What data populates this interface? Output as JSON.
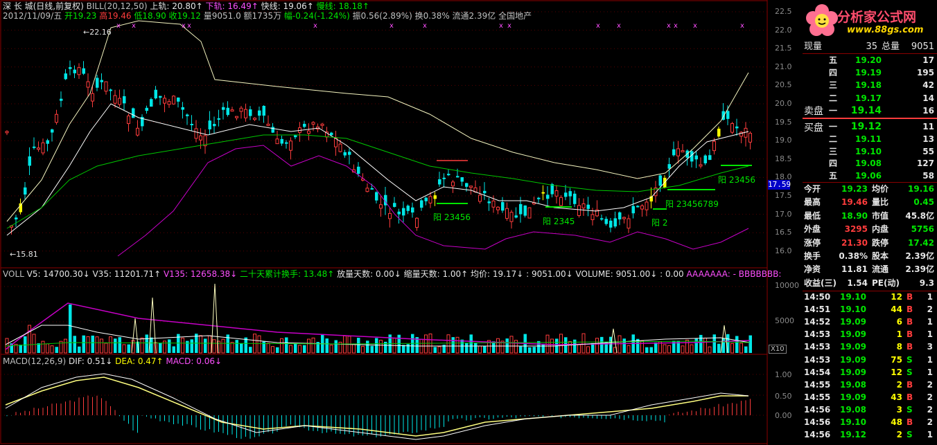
{
  "header": {
    "line1": [
      {
        "t": "深 长 城(日线,前复权)",
        "c": "#e6e6e6"
      },
      {
        "t": " BILL(20,12,50)",
        "c": "#c0c0c0"
      },
      {
        "t": " 上轨: 20.80↑",
        "c": "#e6e6e6"
      },
      {
        "t": " 下轨: 16.49↑",
        "c": "#ff50ff"
      },
      {
        "t": " 快线: 19.06↑",
        "c": "#e6e6e6"
      },
      {
        "t": " 慢线: 18.18↑",
        "c": "#00e600"
      }
    ],
    "line2": [
      {
        "t": "2012/11/09/五",
        "c": "#c0c0c0"
      },
      {
        "t": " 开19.23",
        "c": "#00e600"
      },
      {
        "t": " 高19.46",
        "c": "#ff3c3c"
      },
      {
        "t": " 低18.90",
        "c": "#00e600"
      },
      {
        "t": " 收19.12",
        "c": "#00e600"
      },
      {
        "t": " 量9051.0",
        "c": "#c0c0c0"
      },
      {
        "t": " 额1735万",
        "c": "#c0c0c0"
      },
      {
        "t": " 幅-0.24(-1.24%)",
        "c": "#00e600"
      },
      {
        "t": " 振0.56(2.89%)",
        "c": "#c0c0c0"
      },
      {
        "t": " 换0.38%",
        "c": "#c0c0c0"
      },
      {
        "t": " 流通2.39亿",
        "c": "#c0c0c0"
      },
      {
        "t": " 全国地产",
        "c": "#c0c0c0"
      }
    ]
  },
  "price_axis": [
    "22.5",
    "22.0",
    "21.5",
    "21.0",
    "20.5",
    "20.0",
    "19.5",
    "19.0",
    "18.5",
    "18.0",
    "17.5",
    "17.0",
    "16.5",
    "16.0"
  ],
  "current_price_tag": "17.59",
  "annotations": {
    "high": "22.16",
    "low": "15.81",
    "yang1": "阳 23456",
    "yang2": "阳 2345",
    "yang3": "阳 2",
    "yang4": "阳 23456789",
    "yang5": "阳 23456"
  },
  "vol_header": [
    {
      "t": "VOLL",
      "c": "#c0c0c0"
    },
    {
      "t": "  V5: 14700.30↓",
      "c": "#e6e6e6"
    },
    {
      "t": "  V35: 11201.71↑",
      "c": "#e6e6e6"
    },
    {
      "t": "  V135: 12658.38↓",
      "c": "#ff50ff"
    },
    {
      "t": "  二十天累计换手: 13.48↑",
      "c": "#00e600"
    },
    {
      "t": "  放量天数: 0.00↓",
      "c": "#e6e6e6"
    },
    {
      "t": "  缩量天数: 1.00↑",
      "c": "#e6e6e6"
    },
    {
      "t": "  均价: 19.17↓",
      "c": "#e6e6e6"
    },
    {
      "t": "  : 9051.00↓",
      "c": "#e6e6e6"
    },
    {
      "t": "  VOLUME: 9051.00↓",
      "c": "#e6e6e6"
    },
    {
      "t": "  : 0.00",
      "c": "#e6e6e6"
    },
    {
      "t": "  AAAAAAA: -",
      "c": "#ff50ff"
    },
    {
      "t": "  BBBBBBB:",
      "c": "#ff50ff"
    }
  ],
  "vol_axis": [
    "10000",
    "5000"
  ],
  "vol_unit": "X10",
  "macd_header": [
    {
      "t": "MACD(12,26,9)",
      "c": "#c0c0c0"
    },
    {
      "t": "  DIF: 0.51↓",
      "c": "#e6e6e6"
    },
    {
      "t": "  DEA: 0.47↑",
      "c": "#ffff00"
    },
    {
      "t": "  MACD: 0.06↓",
      "c": "#ff50ff"
    }
  ],
  "macd_axis": [
    "1.00",
    "0.50",
    "0.00"
  ],
  "logo_text": "分析家公式网",
  "logo_url": "www.88gs.com",
  "summary": {
    "xl_label": "现量",
    "xl": "35",
    "zl_label": "总量",
    "zl": "9051"
  },
  "sell": [
    {
      "label": "五",
      "price": "19.20",
      "vol": "17"
    },
    {
      "label": "四",
      "price": "19.19",
      "vol": "195"
    },
    {
      "label": "三",
      "price": "19.18",
      "vol": "42"
    },
    {
      "label": "二",
      "price": "19.17",
      "vol": "14"
    },
    {
      "label": "一",
      "price": "19.14",
      "vol": "16"
    }
  ],
  "sell_title": "卖盘",
  "buy_title": "买盘",
  "buy": [
    {
      "label": "一",
      "price": "19.12",
      "vol": "11"
    },
    {
      "label": "二",
      "price": "19.11",
      "vol": "13"
    },
    {
      "label": "三",
      "price": "19.10",
      "vol": "55"
    },
    {
      "label": "四",
      "price": "19.08",
      "vol": "127"
    },
    {
      "label": "五",
      "price": "19.06",
      "vol": "58"
    }
  ],
  "stats": [
    {
      "l1": "今开",
      "v1": "19.23",
      "c1": "#00e600",
      "l2": "均价",
      "v2": "19.16",
      "c2": "#00e600"
    },
    {
      "l1": "最高",
      "v1": "19.46",
      "c1": "#ff3c3c",
      "l2": "量比",
      "v2": "0.45",
      "c2": "#00e600"
    },
    {
      "l1": "最低",
      "v1": "18.90",
      "c1": "#00e600",
      "l2": "市值",
      "v2": "45.8亿",
      "c2": "#e6e6e6"
    },
    {
      "l1": "外盘",
      "v1": "3295",
      "c1": "#ff3c3c",
      "l2": "内盘",
      "v2": "5756",
      "c2": "#00e600"
    },
    {
      "l1": "涨停",
      "v1": "21.30",
      "c1": "#ff3c3c",
      "l2": "跌停",
      "v2": "17.42",
      "c2": "#00e600"
    },
    {
      "l1": "换手",
      "v1": "0.38%",
      "c1": "#e6e6e6",
      "l2": "股本",
      "v2": "2.39亿",
      "c2": "#e6e6e6"
    },
    {
      "l1": "净资",
      "v1": "11.81",
      "c1": "#e6e6e6",
      "l2": "流通",
      "v2": "2.39亿",
      "c2": "#e6e6e6"
    },
    {
      "l1": "收益(三)",
      "v1": "1.54",
      "c1": "#e6e6e6",
      "l2": "PE(动)",
      "v2": "9.3",
      "c2": "#e6e6e6"
    }
  ],
  "ticks": [
    {
      "time": "14:50",
      "price": "19.10",
      "vol": "12",
      "bs": "B",
      "n": "1"
    },
    {
      "time": "14:51",
      "price": "19.10",
      "vol": "44",
      "bs": "B",
      "n": "2"
    },
    {
      "time": "14:52",
      "price": "19.09",
      "vol": "6",
      "bs": "B",
      "n": "1"
    },
    {
      "time": "14:53",
      "price": "19.09",
      "vol": "1",
      "bs": "B",
      "n": "1"
    },
    {
      "time": "14:53",
      "price": "19.09",
      "vol": "8",
      "bs": "B",
      "n": "3"
    },
    {
      "time": "14:53",
      "price": "19.09",
      "vol": "75",
      "bs": "S",
      "n": "1"
    },
    {
      "time": "14:54",
      "price": "19.09",
      "vol": "12",
      "bs": "S",
      "n": "1"
    },
    {
      "time": "14:55",
      "price": "19.08",
      "vol": "2",
      "bs": "B",
      "n": "2"
    },
    {
      "time": "14:55",
      "price": "19.09",
      "vol": "43",
      "bs": "B",
      "n": "2"
    },
    {
      "time": "14:56",
      "price": "19.08",
      "vol": "3",
      "bs": "S",
      "n": "2"
    },
    {
      "time": "14:56",
      "price": "19.10",
      "vol": "48",
      "bs": "B",
      "n": "2"
    },
    {
      "time": "14:56",
      "price": "19.12",
      "vol": "2",
      "bs": "S",
      "n": "1"
    }
  ],
  "colors": {
    "up": "#ff3c3c",
    "down": "#00e6e6",
    "yellow": "#ffff00",
    "grid": "#8b0000"
  }
}
